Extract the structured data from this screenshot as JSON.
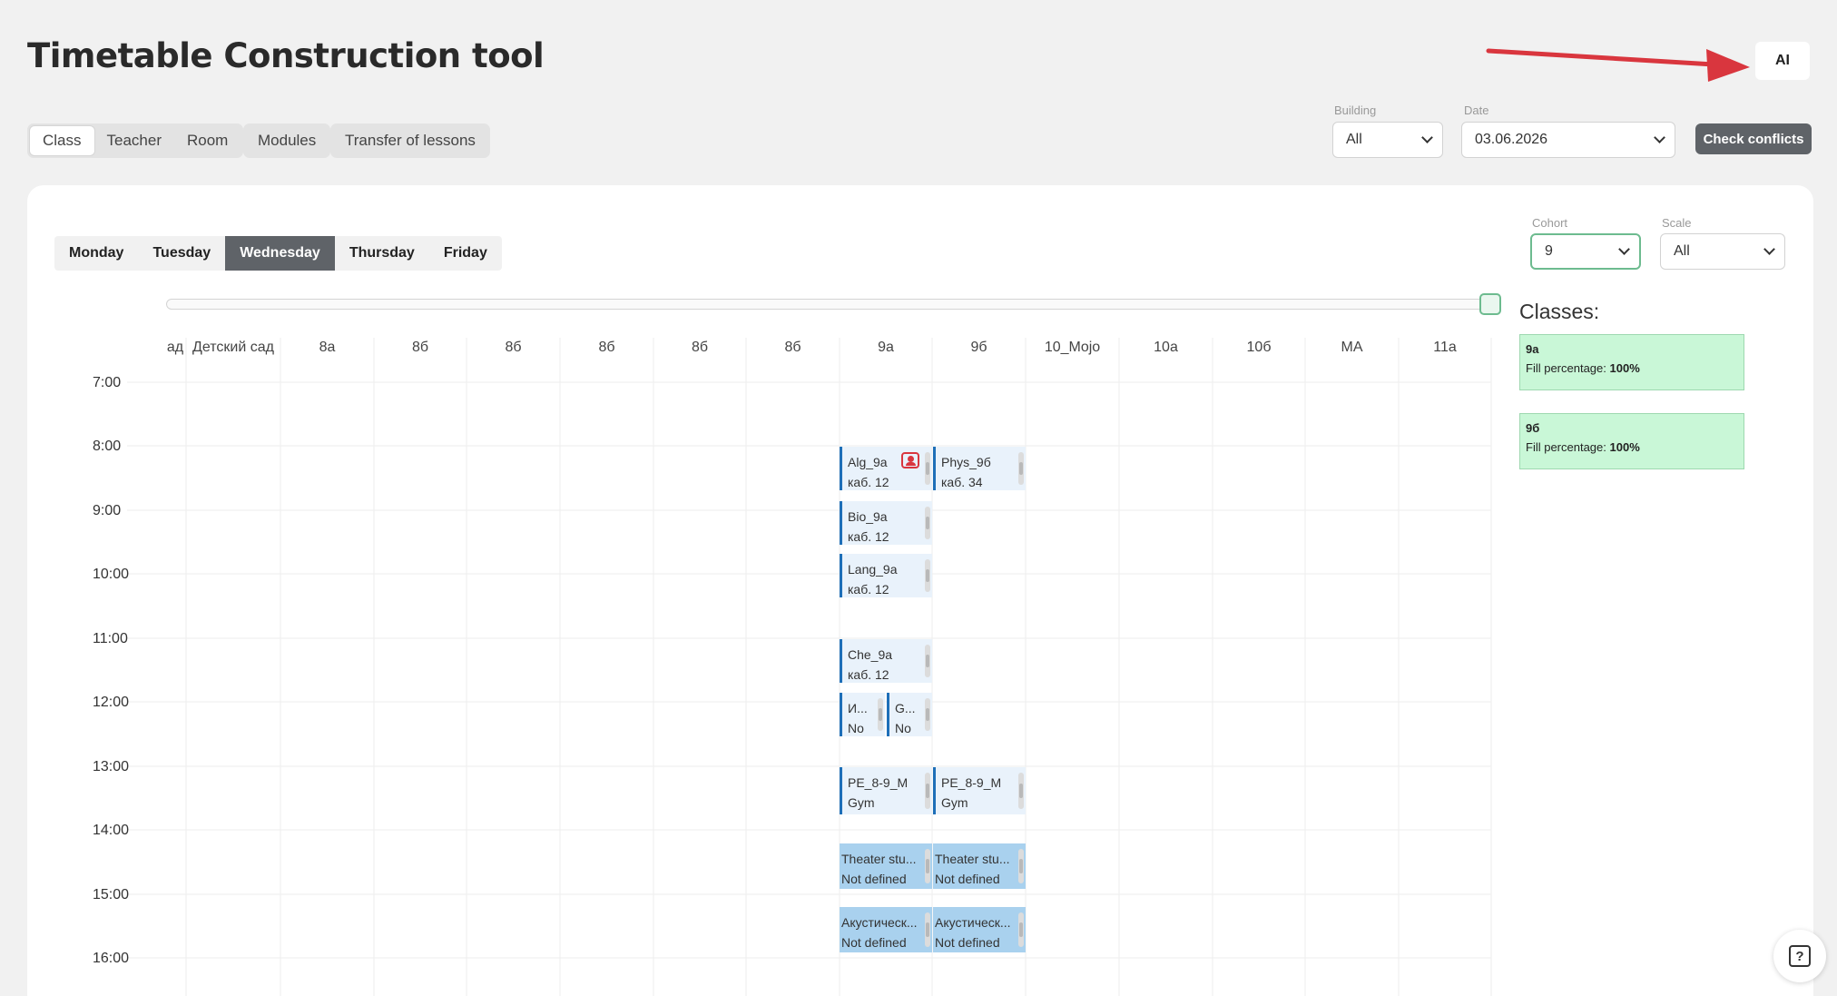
{
  "header": {
    "title": "Timetable Construction tool",
    "ai_label": "AI"
  },
  "mode_tabs": [
    "Class",
    "Teacher",
    "Room"
  ],
  "extra_tabs": [
    "Modules",
    "Transfer of lessons"
  ],
  "filters": {
    "building": {
      "label": "Building",
      "value": "All"
    },
    "date": {
      "label": "Date",
      "value": "03.06.2026"
    },
    "check_label": "Check conflicts",
    "cohort": {
      "label": "Cohort",
      "value": "9"
    },
    "scale": {
      "label": "Scale",
      "value": "All"
    }
  },
  "days": [
    "Monday",
    "Tuesday",
    "Wednesday",
    "Thursday",
    "Friday"
  ],
  "active_day": "Wednesday",
  "columns": [
    "ад",
    "Детский сад",
    "8а",
    "8б",
    "8б",
    "8б",
    "8б",
    "8б",
    "9а",
    "9б",
    "10_Mojo",
    "10а",
    "10б",
    "МА",
    "11а"
  ],
  "times": [
    "7:00",
    "8:00",
    "9:00",
    "10:00",
    "11:00",
    "12:00",
    "13:00",
    "14:00",
    "15:00",
    "16:00"
  ],
  "lessons": [
    {
      "l1": "Alg_9a",
      "l2": "каб. 12"
    },
    {
      "l1": "Phys_9б",
      "l2": "каб. 34"
    },
    {
      "l1": "Bio_9a",
      "l2": "каб. 12"
    },
    {
      "l1": "Lang_9a",
      "l2": "каб. 12"
    },
    {
      "l1": "Che_9a",
      "l2": "каб. 12"
    },
    {
      "l1": "И...",
      "l2": "No"
    },
    {
      "l1": "G...",
      "l2": "No"
    },
    {
      "l1": "PE_8-9_M",
      "l2": "Gym"
    },
    {
      "l1": "PE_8-9_M",
      "l2": "Gym"
    },
    {
      "l1": "Theater stu...",
      "l2": "Not defined"
    },
    {
      "l1": "Theater stu...",
      "l2": "Not defined"
    },
    {
      "l1": "Акустическ...",
      "l2": "Not defined"
    },
    {
      "l1": "Акустическ...",
      "l2": "Not defined"
    }
  ],
  "classes_panel": {
    "title": "Classes:",
    "fill_label": "Fill percentage:",
    "items": [
      {
        "name": "9а",
        "fill": "100%"
      },
      {
        "name": "9б",
        "fill": "100%"
      }
    ]
  },
  "icons": {
    "help": "help-icon",
    "teacher": "teacher-icon",
    "arrow": "red-arrow"
  },
  "colors": {
    "accent": "#5f6368",
    "lesson_border": "#1e6fb8",
    "card_green": "#c9f7d7",
    "arrow": "#d9363e"
  }
}
